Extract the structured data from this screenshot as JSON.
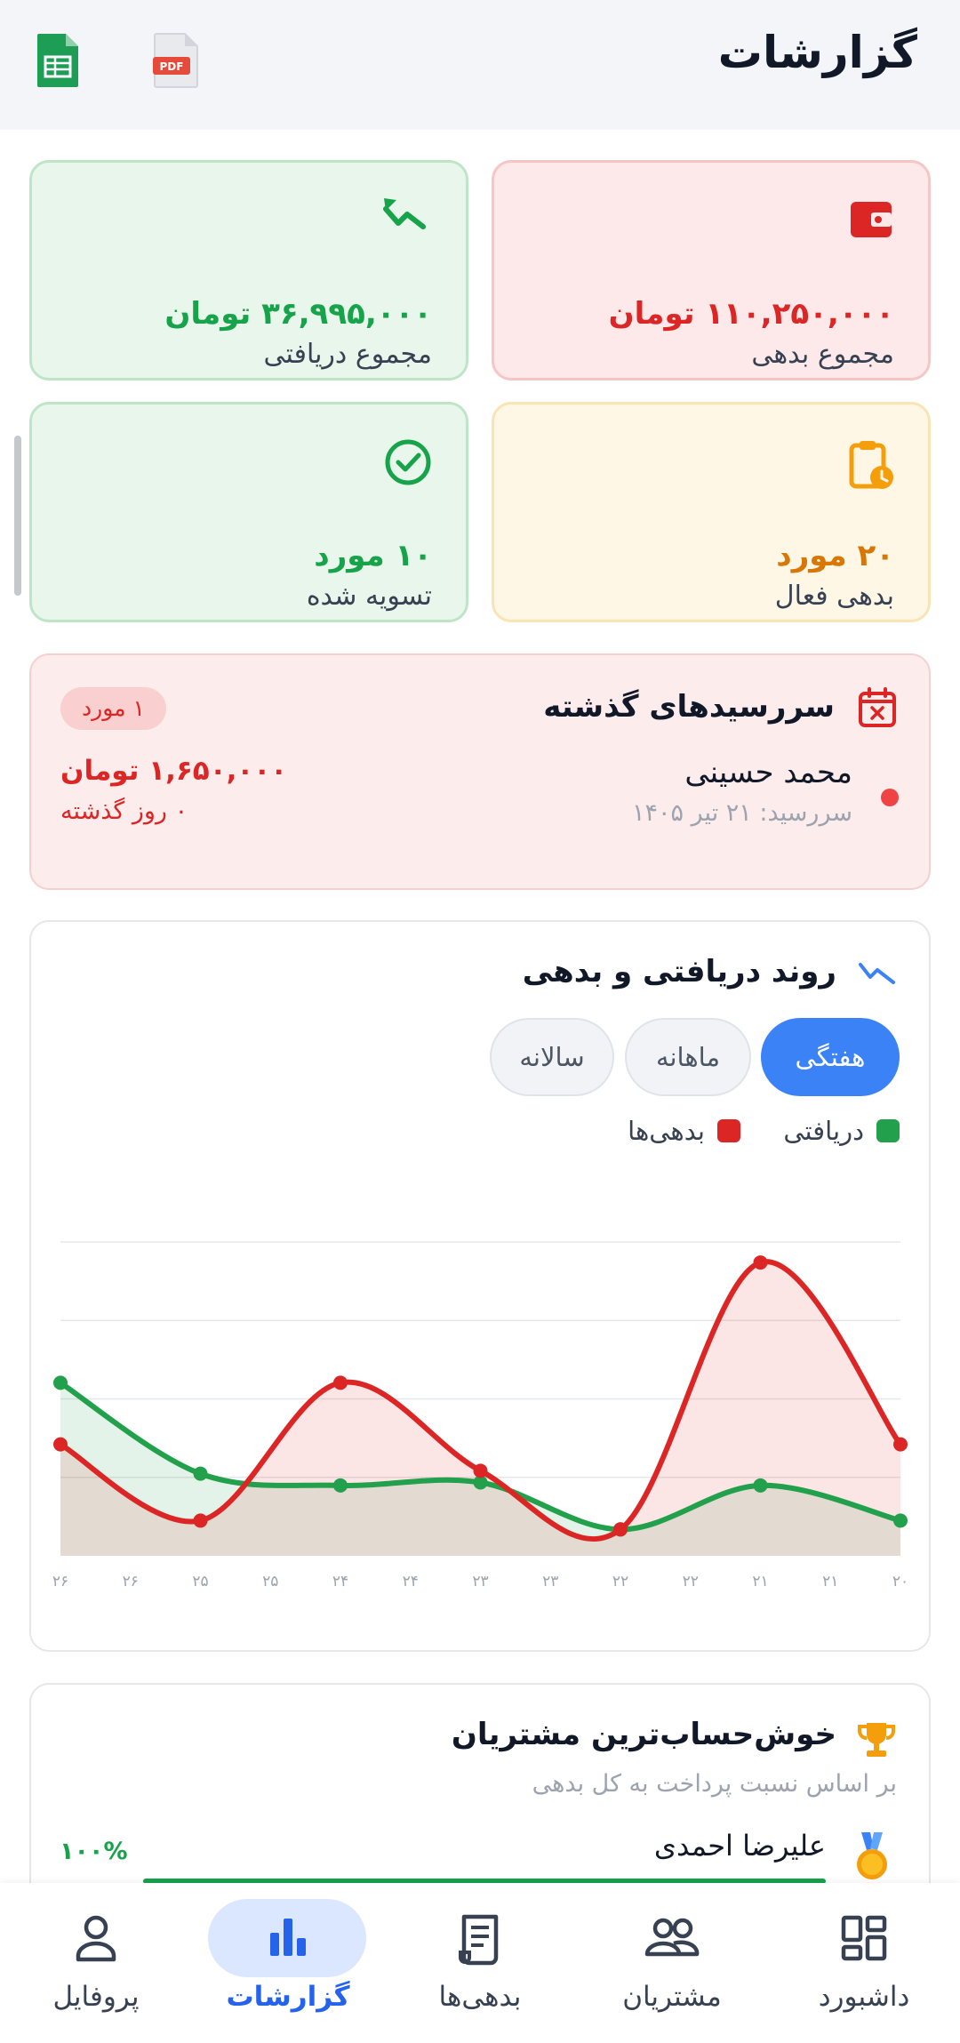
{
  "header": {
    "title": "گزارشات",
    "pdf_label": "PDF"
  },
  "summary": {
    "total_debt": {
      "value": "۱۱۰,۲۵۰,۰۰۰ تومان",
      "label": "مجموع بدهی"
    },
    "total_received": {
      "value": "۳۶,۹۹۵,۰۰۰ تومان",
      "label": "مجموع دریافتی"
    },
    "active_debts": {
      "value": "۲۰ مورد",
      "label": "بدهی فعال"
    },
    "settled": {
      "value": "۱۰ مورد",
      "label": "تسویه شده"
    }
  },
  "overdue": {
    "title": "سررسیدهای گذشته",
    "badge": "۱ مورد",
    "item": {
      "name": "محمد حسینی",
      "due": "سررسید: ۲۱ تیر ۱۴۰۵",
      "amount": "۱,۶۵۰,۰۰۰ تومان",
      "days_ago": "۰ روز گذشته"
    }
  },
  "trend": {
    "title": "روند دریافتی و بدهی",
    "periods": [
      "هفتگی",
      "ماهانه",
      "سالانه"
    ],
    "active_period": "هفتگی",
    "legend": {
      "received": "دریافتی",
      "debts": "بدهی‌ها"
    }
  },
  "chart_data": {
    "type": "area",
    "x": [
      "۲۰",
      "۲۱",
      "۲۱",
      "۲۲",
      "۲۲",
      "۲۳",
      "۲۳",
      "۲۴",
      "۲۴",
      "۲۵",
      "۲۵",
      "۲۶",
      "۲۶"
    ],
    "x_direction": "right-to-left",
    "grid": true,
    "series": [
      {
        "name": "دریافتی",
        "color": "#22a04b",
        "values": [
          0.6,
          null,
          1.2,
          null,
          0.45,
          null,
          1.25,
          null,
          1.2,
          null,
          1.4,
          null,
          2.95
        ]
      },
      {
        "name": "بدهی‌ها",
        "color": "#dc2626",
        "values": [
          1.9,
          null,
          5.0,
          null,
          0.45,
          null,
          1.45,
          null,
          2.95,
          null,
          0.6,
          null,
          1.9
        ]
      }
    ]
  },
  "best": {
    "title": "خوش‌حساب‌ترین مشتریان",
    "subtitle": "بر اساس نسبت پرداخت به کل بدهی",
    "customer": {
      "name": "علیرضا احمدی",
      "percent": "۱۰۰%"
    }
  },
  "nav": {
    "items": [
      {
        "label": "داشبورد",
        "icon": "dashboard-icon"
      },
      {
        "label": "مشتریان",
        "icon": "users-icon"
      },
      {
        "label": "بدهی‌ها",
        "icon": "receipt-icon"
      },
      {
        "label": "گزارشات",
        "icon": "chart-icon"
      },
      {
        "label": "پروفایل",
        "icon": "person-icon"
      }
    ],
    "active": "گزارشات"
  },
  "colors": {
    "accent": "#3b82f6",
    "red": "#dc2626",
    "green": "#16a34a",
    "amber": "#f59e0b"
  }
}
